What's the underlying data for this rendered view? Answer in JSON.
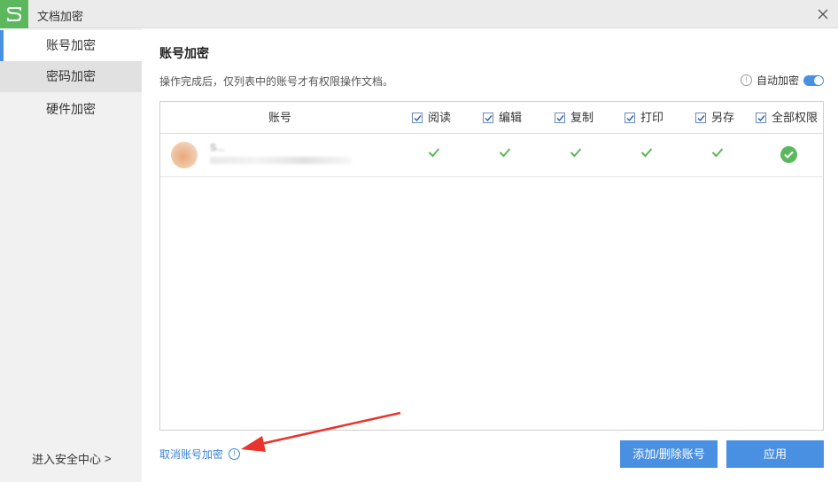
{
  "window": {
    "title": "文档加密"
  },
  "sidebar": {
    "items": [
      {
        "label": "账号加密",
        "state": "active"
      },
      {
        "label": "密码加密",
        "state": "hover"
      },
      {
        "label": "硬件加密",
        "state": "normal"
      }
    ],
    "security_center": "进入安全中心",
    "security_center_chevron": ">"
  },
  "main": {
    "title": "账号加密",
    "description": "操作完成后，仅列表中的账号才有权限操作文档。",
    "auto_encrypt": {
      "label": "自动加密",
      "enabled": true,
      "info_glyph": "!"
    }
  },
  "table": {
    "account_header": "账号",
    "permissions": [
      {
        "label": "阅读",
        "checked": true
      },
      {
        "label": "编辑",
        "checked": true
      },
      {
        "label": "复制",
        "checked": true
      },
      {
        "label": "打印",
        "checked": true
      },
      {
        "label": "另存",
        "checked": true
      },
      {
        "label": "全部权限",
        "checked": true
      }
    ],
    "rows": [
      {
        "name": "S...",
        "avatar": "avatar-icon",
        "permissions": [
          true,
          true,
          true,
          true,
          true,
          true
        ]
      }
    ]
  },
  "footer": {
    "cancel_label": "取消账号加密",
    "cancel_info_glyph": "!",
    "add_remove_label": "添加/删除账号",
    "apply_label": "应用"
  },
  "colors": {
    "accent": "#4a90e2",
    "link": "#3b83d8",
    "check_green": "#5cb85c",
    "arrow_red": "#e8342c",
    "sidebar_bg": "#f1f1f1"
  }
}
